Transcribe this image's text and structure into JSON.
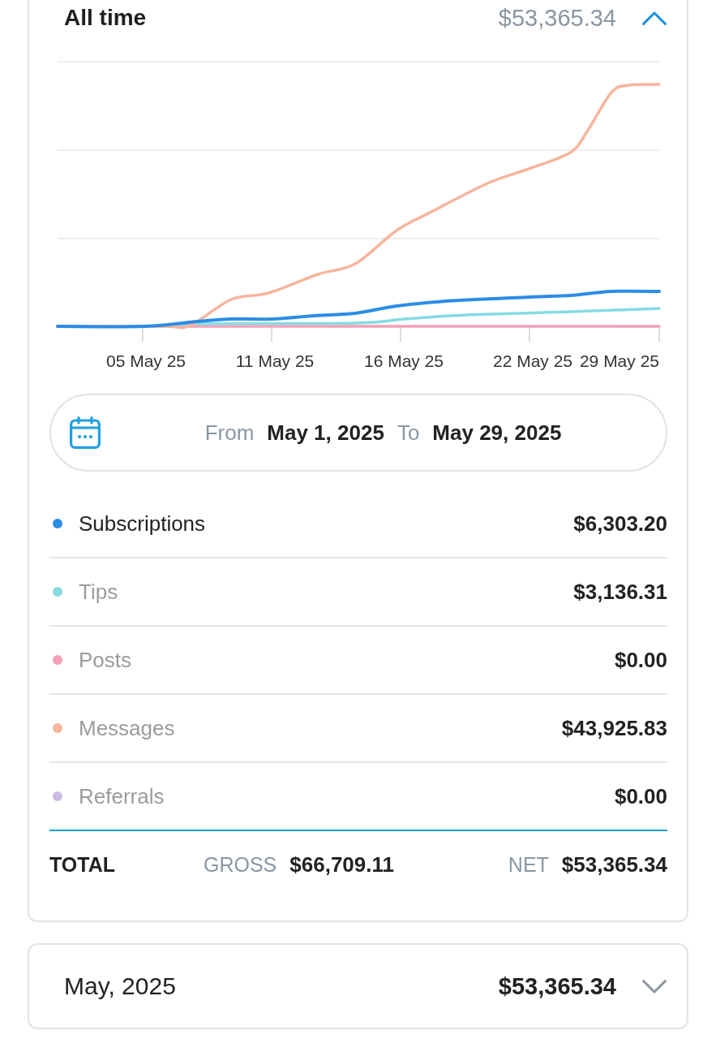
{
  "periods": [
    {
      "label": "All time",
      "amount": "$53,365.34",
      "expanded": true,
      "chart": {
        "x_labels": [
          "05 May 25",
          "11 May 25",
          "16 May 25",
          "22 May 25",
          "29 May 25"
        ]
      },
      "date_range": {
        "from_label": "From",
        "from": "May 1, 2025",
        "to_label": "To",
        "to": "May 29, 2025"
      },
      "categories": [
        {
          "name": "Subscriptions",
          "amount": "$6,303.20",
          "color": "#2b8de6",
          "selected": true
        },
        {
          "name": "Tips",
          "amount": "$3,136.31",
          "color": "#86dbe3",
          "selected": false
        },
        {
          "name": "Posts",
          "amount": "$0.00",
          "color": "#f2a0b8",
          "selected": false
        },
        {
          "name": "Messages",
          "amount": "$43,925.83",
          "color": "#f8b49c",
          "selected": false
        },
        {
          "name": "Referrals",
          "amount": "$0.00",
          "color": "#cbb9e6",
          "selected": false
        }
      ],
      "total": {
        "label": "TOTAL",
        "gross_label": "GROSS",
        "gross": "$66,709.11",
        "net_label": "NET",
        "net": "$53,365.34"
      }
    },
    {
      "label": "May, 2025",
      "amount": "$53,365.34",
      "expanded": false
    }
  ]
}
